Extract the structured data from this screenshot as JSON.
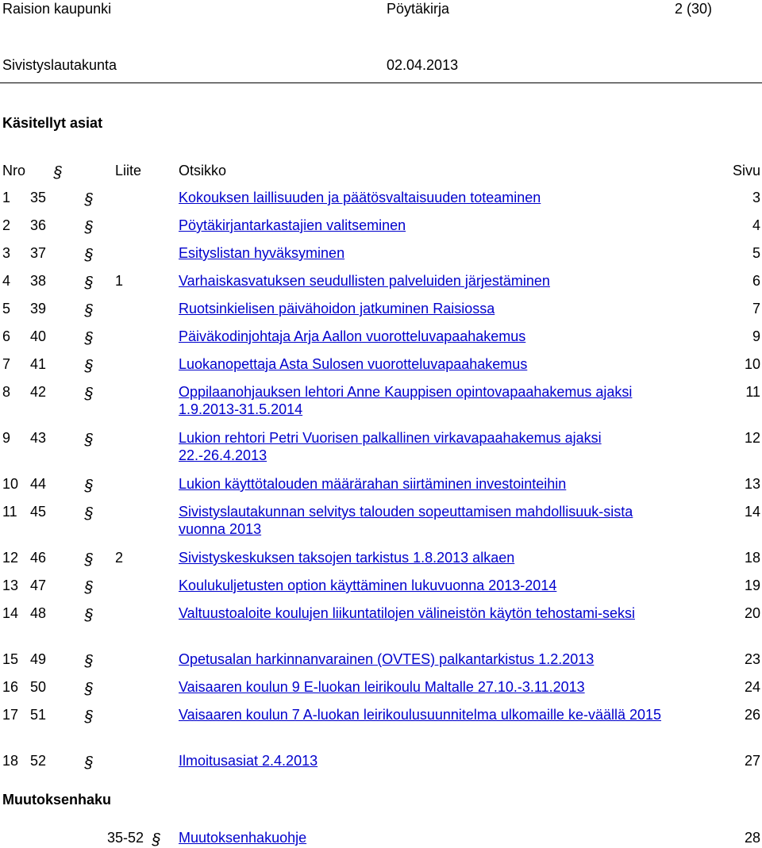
{
  "header": {
    "city": "Raision kaupunki",
    "doc_type": "Pöytäkirja",
    "page": "2 (30)",
    "board": "Sivistyslautakunta",
    "date": "02.04.2013"
  },
  "section_title": "Käsitellyt asiat",
  "columns": {
    "nro": "Nro",
    "liite": "Liite",
    "otsikko": "Otsikko",
    "sivu": "Sivu"
  },
  "items": [
    {
      "nro": "1",
      "par": "35",
      "liite": "",
      "title": "Kokouksen laillisuuden ja päätösvaltaisuuden toteaminen",
      "page": "3"
    },
    {
      "nro": "2",
      "par": "36",
      "liite": "",
      "title": "Pöytäkirjantarkastajien valitseminen",
      "page": "4"
    },
    {
      "nro": "3",
      "par": "37",
      "liite": "",
      "title": "Esityslistan hyväksyminen",
      "page": "5"
    },
    {
      "nro": "4",
      "par": "38",
      "liite": "1",
      "title": "Varhaiskasvatuksen seudullisten palveluiden järjestäminen",
      "page": "6"
    },
    {
      "nro": "5",
      "par": "39",
      "liite": "",
      "title": "Ruotsinkielisen päivähoidon jatkuminen Raisiossa",
      "page": "7"
    },
    {
      "nro": "6",
      "par": "40",
      "liite": "",
      "title": "Päiväkodinjohtaja Arja Aallon vuorotteluvapaahakemus",
      "page": "9"
    },
    {
      "nro": "7",
      "par": "41",
      "liite": "",
      "title": "Luokanopettaja Asta Sulosen vuorotteluvapaahakemus",
      "page": "10"
    },
    {
      "nro": "8",
      "par": "42",
      "liite": "",
      "title": "Oppilaanohjauksen lehtori Anne Kauppisen opintovapaahakemus ajaksi 1.9.2013-31.5.2014",
      "page": "11"
    },
    {
      "nro": "9",
      "par": "43",
      "liite": "",
      "title": "Lukion rehtori Petri Vuorisen palkallinen virkavapaahakemus ajaksi 22.-26.4.2013",
      "page": "12"
    },
    {
      "nro": "10",
      "par": "44",
      "liite": "",
      "title": "Lukion käyttötalouden määrärahan siirtäminen investointeihin",
      "page": "13"
    },
    {
      "nro": "11",
      "par": "45",
      "liite": "",
      "title": "Sivistyslautakunnan selvitys talouden sopeuttamisen mahdollisuuk-sista vuonna 2013",
      "page": "14"
    },
    {
      "nro": "12",
      "par": "46",
      "liite": "2",
      "title": "Sivistyskeskuksen taksojen tarkistus 1.8.2013 alkaen",
      "page": "18"
    },
    {
      "nro": "13",
      "par": "47",
      "liite": "",
      "title": "Koulukuljetusten option käyttäminen lukuvuonna 2013-2014",
      "page": "19"
    },
    {
      "nro": "14",
      "par": "48",
      "liite": "",
      "title": "Valtuustoaloite koulujen liikuntatilojen välineistön käytön tehostami-seksi",
      "page": "20"
    },
    {
      "nro": "15",
      "par": "49",
      "liite": "",
      "title": "Opetusalan harkinnanvarainen (OVTES) palkantarkistus 1.2.2013",
      "page": "23"
    },
    {
      "nro": "16",
      "par": "50",
      "liite": "",
      "title": "Vaisaaren koulun 9 E-luokan leirikoulu Maltalle 27.10.-3.11.2013",
      "page": "24"
    },
    {
      "nro": "17",
      "par": "51",
      "liite": "",
      "title": "Vaisaaren koulun 7 A-luokan leirikoulusuunnitelma ulkomaille ke-väällä 2015",
      "page": "26"
    },
    {
      "nro": "18",
      "par": "52",
      "liite": "",
      "title": "Ilmoitusasiat 2.4.2013",
      "page": "27"
    }
  ],
  "appeal_section": {
    "title": "Muutoksenhaku",
    "range": "35-52",
    "title_link": "Muutoksenhakuohje",
    "page": "28"
  }
}
